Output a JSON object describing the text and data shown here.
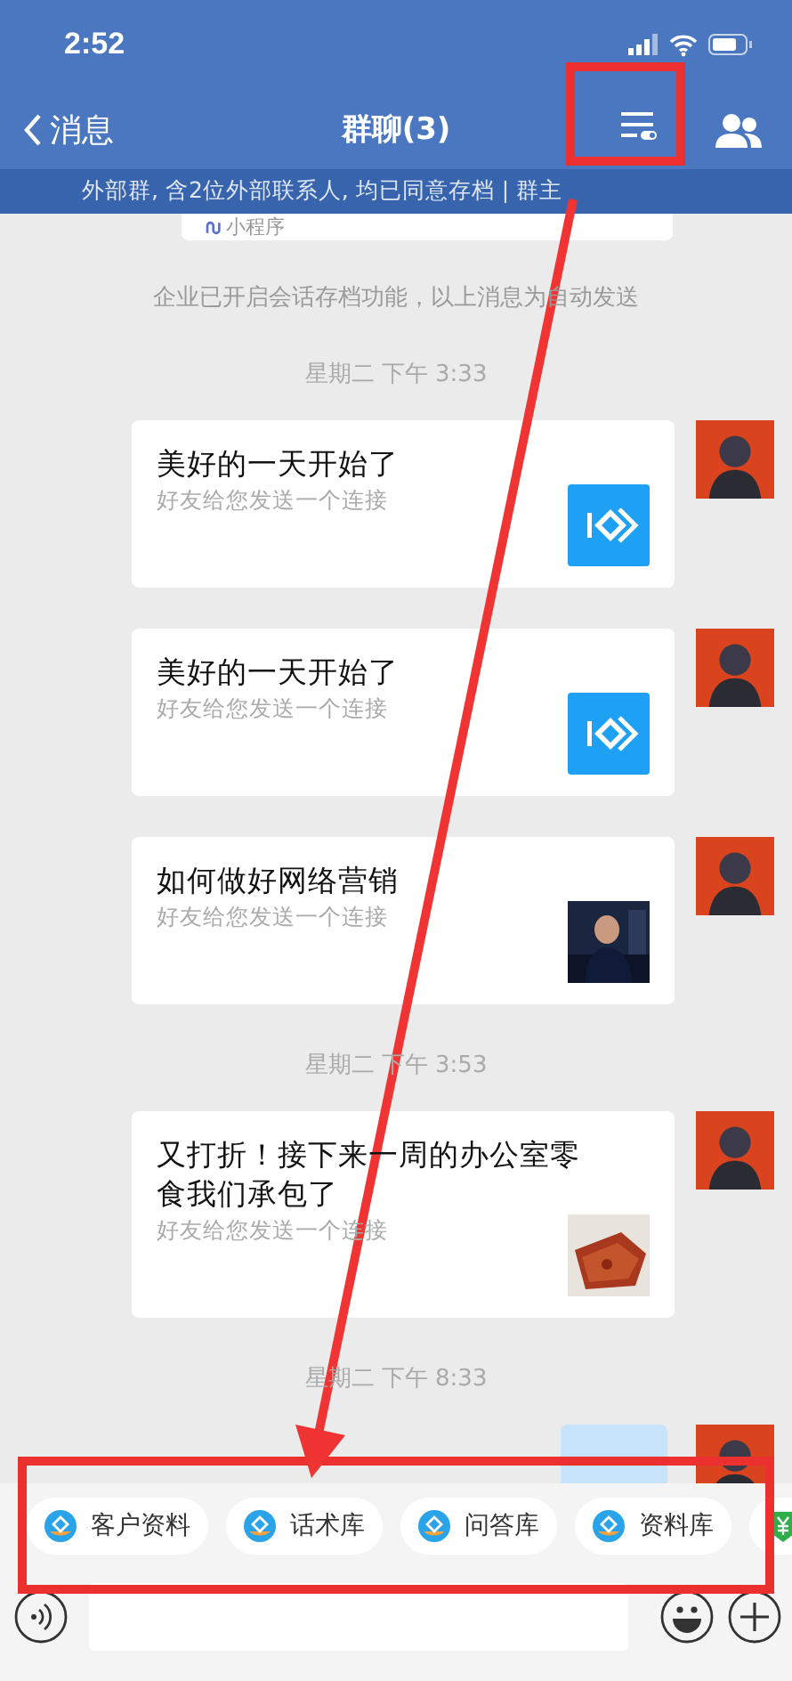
{
  "status_bar": {
    "time": "2:52"
  },
  "nav": {
    "back_label": "消息",
    "title": "群聊(3)",
    "menu_highlighted": true
  },
  "banner": "外部群, 含2位外部联系人, 均已同意存档 | 群主",
  "messages": [
    {
      "kind": "mini_tail",
      "label": "小程序"
    },
    {
      "kind": "notice",
      "text": "企业已开启会话存档功能，以上消息为自动发送"
    },
    {
      "kind": "time",
      "text": "星期二 下午 3:33"
    },
    {
      "kind": "link",
      "title": "美好的一天开始了",
      "subtitle": "好友给您发送一个连接",
      "thumb": {
        "kind": "logo"
      }
    },
    {
      "kind": "link",
      "title": "美好的一天开始了",
      "subtitle": "好友给您发送一个连接",
      "thumb": {
        "kind": "logo"
      }
    },
    {
      "kind": "link",
      "title": "如何做好网络营销",
      "subtitle": "好友给您发送一个连接"
    },
    {
      "kind": "time",
      "text": "星期二 下午 3:53"
    },
    {
      "kind": "link",
      "title": "又打折！接下来一周的办公室零食我们承包了",
      "subtitle": "好友给您发送一个连接"
    },
    {
      "kind": "time",
      "text": "星期二 下午 8:33"
    },
    {
      "kind": "clipped_bubble"
    }
  ],
  "toolbar": {
    "highlighted": true,
    "chips": [
      {
        "label": "客户资料",
        "kind": "logo"
      },
      {
        "label": "话术库",
        "kind": "logo"
      },
      {
        "label": "问答库",
        "kind": "logo"
      },
      {
        "label": "资料库",
        "kind": "logo"
      },
      {
        "kind": "money"
      }
    ]
  },
  "annotation_arrow": true
}
